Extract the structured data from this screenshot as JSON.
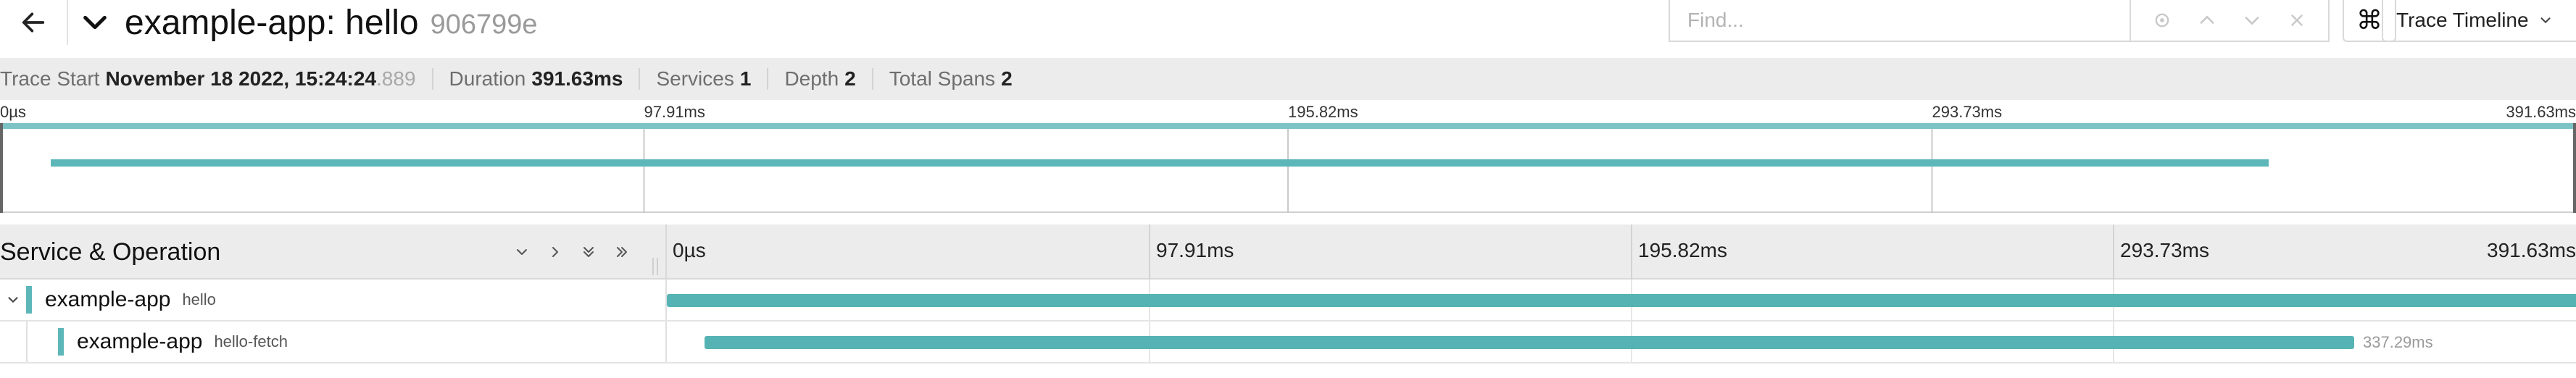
{
  "header": {
    "back_icon": "arrow-left-icon",
    "collapse_icon": "chevron-down-icon",
    "service_operation": "example-app: hello",
    "trace_id_short": "906799e",
    "find_placeholder": "Find...",
    "find_controls": [
      "locate-icon",
      "arrow-up-icon",
      "arrow-down-icon",
      "close-icon"
    ],
    "keyboard_icon": "command-key-icon",
    "view_label": "Trace Timeline"
  },
  "summary": {
    "trace_start_label": "Trace Start",
    "trace_start_value": "November 18 2022, 15:24:24",
    "trace_start_ms": ".889",
    "duration_label": "Duration",
    "duration_value": "391.63ms",
    "services_label": "Services",
    "services_value": "1",
    "depth_label": "Depth",
    "depth_value": "2",
    "total_spans_label": "Total Spans",
    "total_spans_value": "2"
  },
  "minimap": {
    "ticks": [
      "0µs",
      "97.91ms",
      "195.82ms",
      "293.73ms",
      "391.63ms"
    ],
    "bar_color": "#5db7b9",
    "spans": [
      {
        "start_ms": 0,
        "end_ms": 391.63
      },
      {
        "start_ms": 7.5,
        "end_ms": 344.79
      }
    ]
  },
  "timeline": {
    "left_title": "Service & Operation",
    "expander_icons": [
      "chevron-down-icon",
      "chevron-right-icon",
      "double-chevron-down-icon",
      "double-chevron-right-icon"
    ],
    "ticks": [
      "0µs",
      "97.91ms",
      "195.82ms",
      "293.73ms",
      "391.63ms"
    ],
    "total_ms": 391.63
  },
  "spans": [
    {
      "service": "example-app",
      "operation": "hello",
      "depth": 0,
      "expandable": true,
      "start_ms": 0,
      "duration_ms": 391.63,
      "duration_label": ""
    },
    {
      "service": "example-app",
      "operation": "hello-fetch",
      "depth": 1,
      "expandable": false,
      "start_ms": 7.5,
      "duration_ms": 337.29,
      "duration_label": "337.29ms"
    }
  ],
  "colors": {
    "service_color": "#5db7b9",
    "summary_bg": "#ececec"
  }
}
